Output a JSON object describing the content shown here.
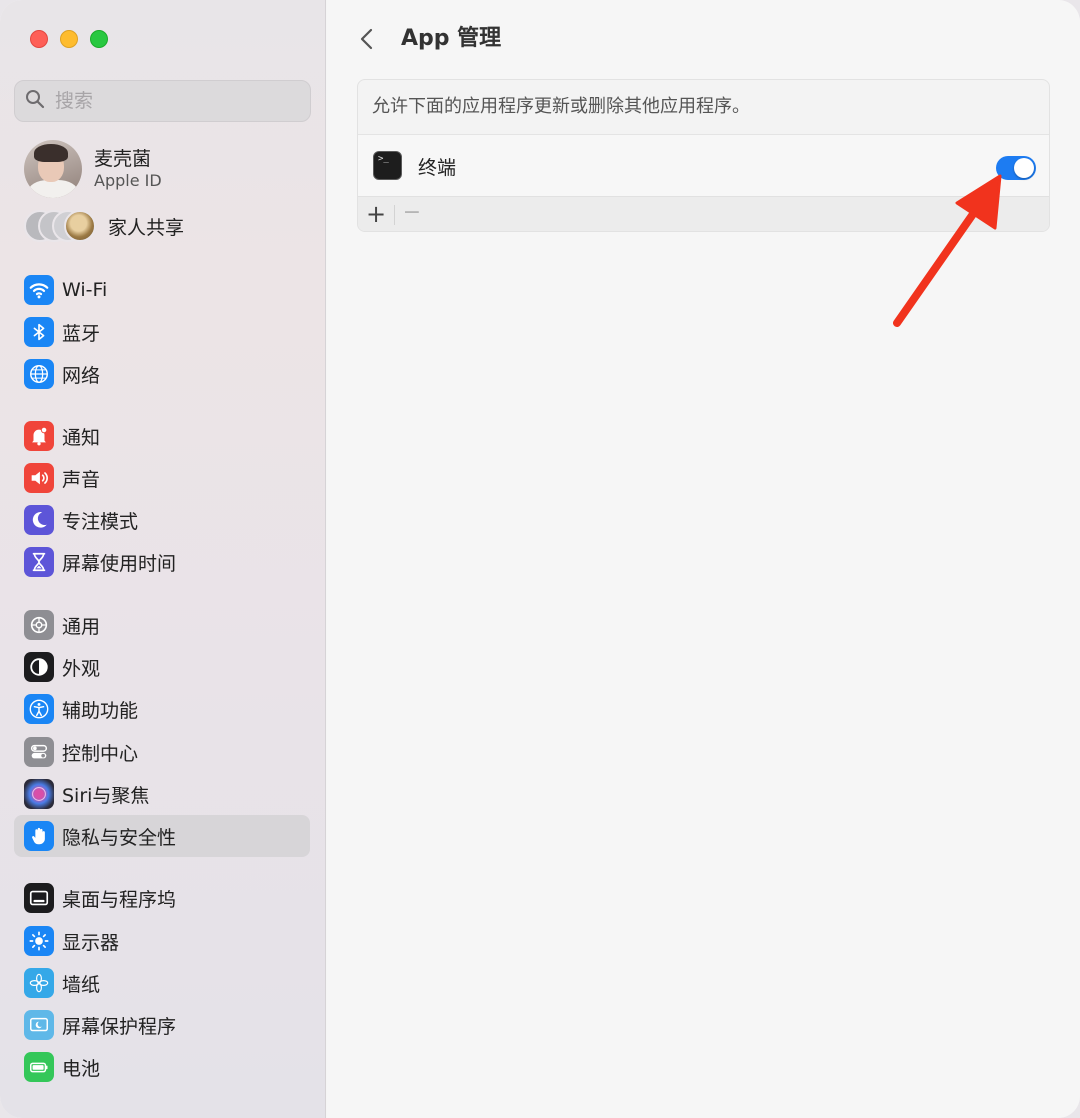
{
  "window_controls": {
    "close": "close",
    "minimize": "minimize",
    "zoom": "zoom"
  },
  "search": {
    "placeholder": "搜索"
  },
  "profile": {
    "name": "麦壳菌",
    "subtitle": "Apple ID"
  },
  "family": {
    "label": "家人共享"
  },
  "sidebar": {
    "items": [
      {
        "label": "Wi-Fi",
        "icon": "wifi-icon",
        "color": "#1a86f5"
      },
      {
        "label": "蓝牙",
        "icon": "bluetooth-icon",
        "color": "#1a86f5"
      },
      {
        "label": "网络",
        "icon": "globe-icon",
        "color": "#1a86f5"
      },
      {
        "label": "通知",
        "icon": "bell-icon",
        "color": "#f0453a"
      },
      {
        "label": "声音",
        "icon": "speaker-icon",
        "color": "#f0453a"
      },
      {
        "label": "专注模式",
        "icon": "moon-icon",
        "color": "#5d55d8"
      },
      {
        "label": "屏幕使用时间",
        "icon": "hourglass-icon",
        "color": "#5d55d8"
      },
      {
        "label": "通用",
        "icon": "gear-icon",
        "color": "#8e8e93"
      },
      {
        "label": "外观",
        "icon": "appearance-icon",
        "color": "#1c1c1e"
      },
      {
        "label": "辅助功能",
        "icon": "accessibility-icon",
        "color": "#1a86f5"
      },
      {
        "label": "控制中心",
        "icon": "control-center-icon",
        "color": "#8e8e93"
      },
      {
        "label": "Siri与聚焦",
        "icon": "siri-icon",
        "color": "#2b2b3a"
      },
      {
        "label": "隐私与安全性",
        "icon": "hand-icon",
        "color": "#1a86f5"
      },
      {
        "label": "桌面与程序坞",
        "icon": "dock-icon",
        "color": "#1c1c1e"
      },
      {
        "label": "显示器",
        "icon": "sun-icon",
        "color": "#1a86f5"
      },
      {
        "label": "墙纸",
        "icon": "flower-icon",
        "color": "#35a8e8"
      },
      {
        "label": "屏幕保护程序",
        "icon": "screensaver-icon",
        "color": "#5fb8e8"
      },
      {
        "label": "电池",
        "icon": "battery-icon",
        "color": "#34c759"
      }
    ],
    "selected": "隐私与安全性"
  },
  "main": {
    "title": "App 管理",
    "description": "允许下面的应用程序更新或删除其他应用程序。",
    "apps": [
      {
        "name": "终端",
        "icon": "terminal-icon",
        "enabled": true
      }
    ],
    "add_label": "+",
    "remove_label": "−"
  },
  "colors": {
    "accent": "#1d7cf2",
    "annotation": "#f1331d"
  }
}
